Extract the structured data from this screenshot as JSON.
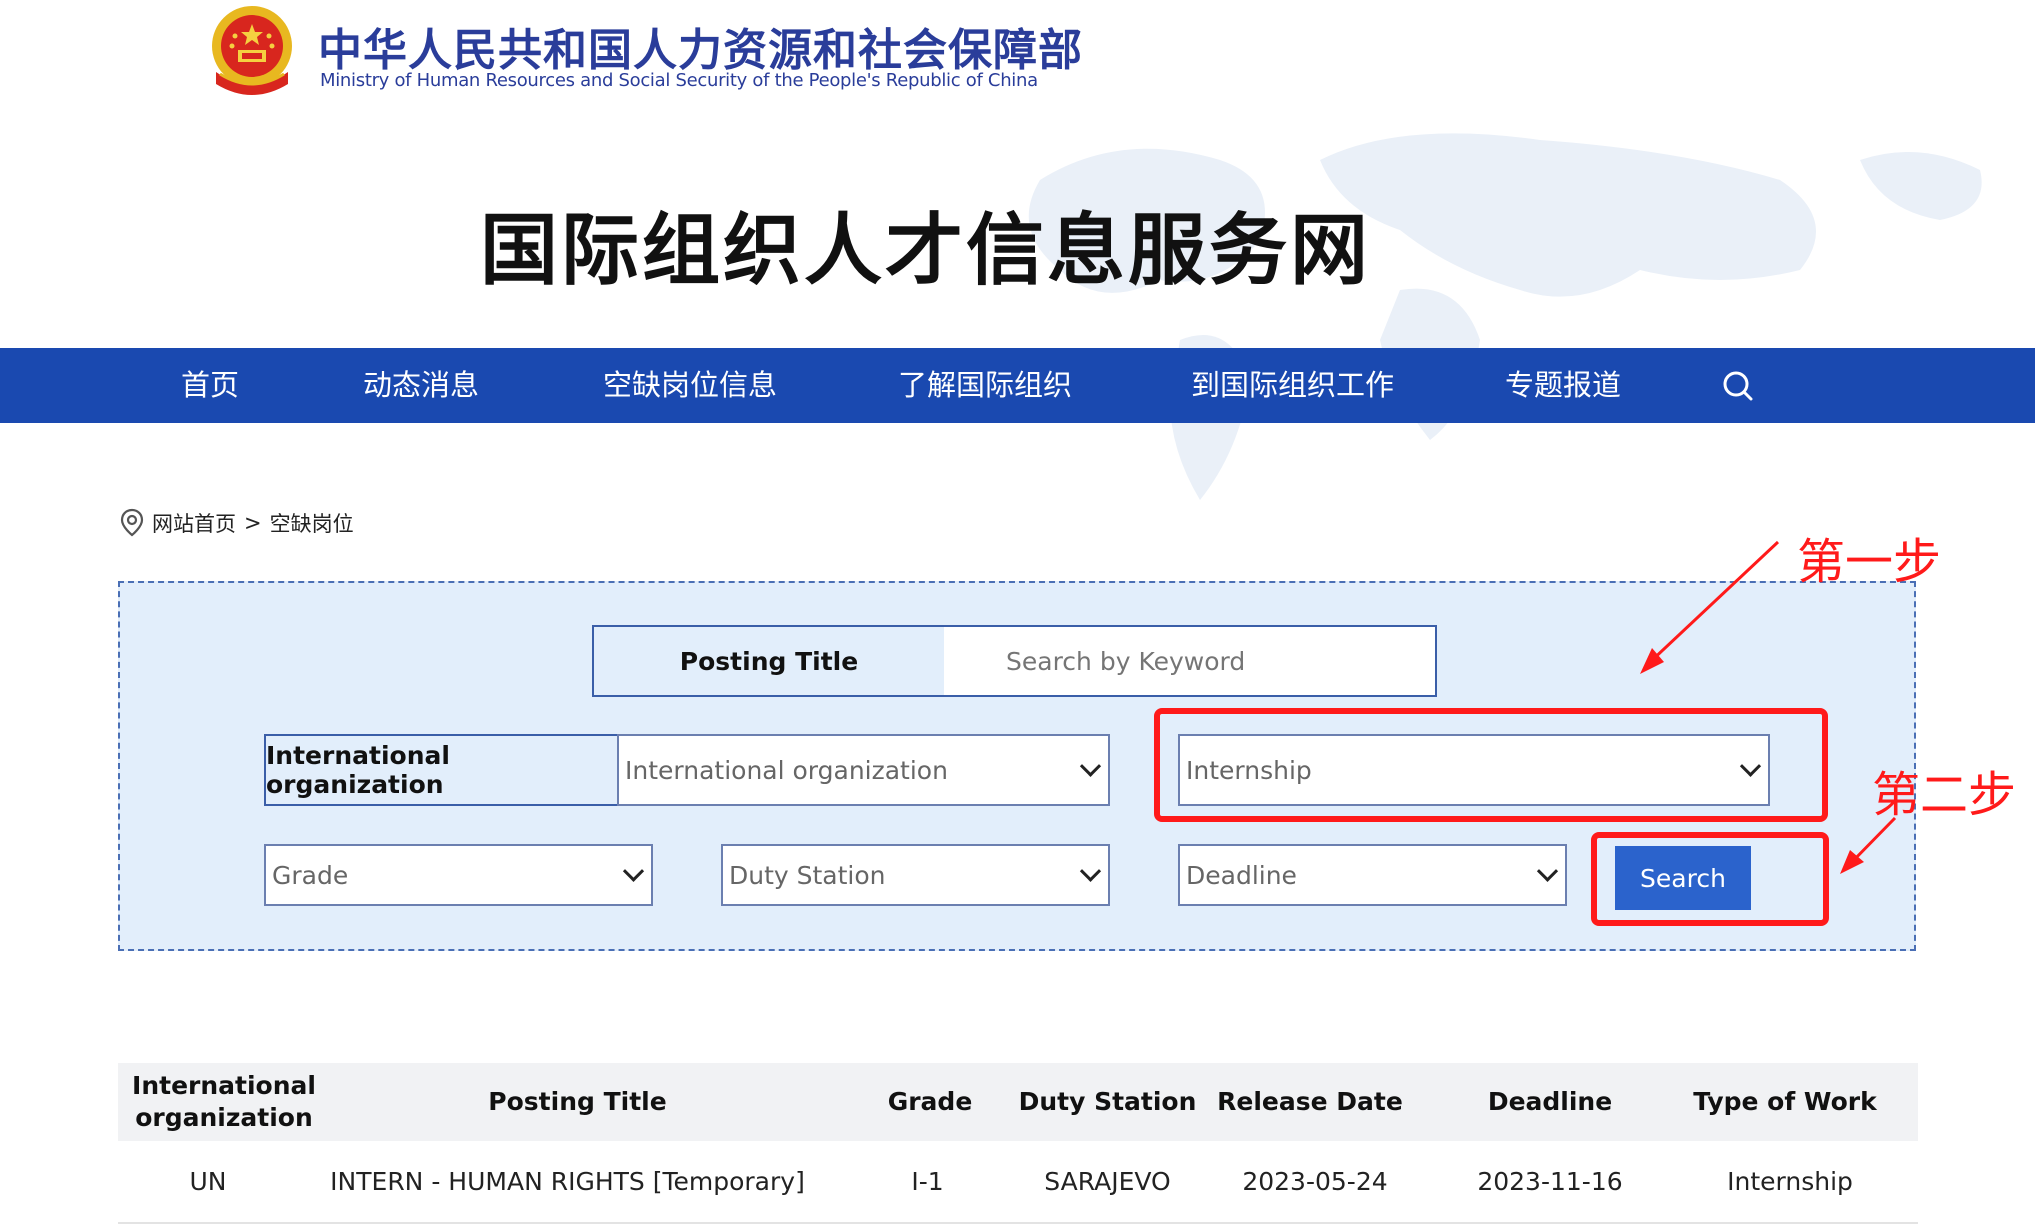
{
  "header": {
    "ministry_cn": "中华人民共和国人力资源和社会保障部",
    "ministry_en": "Ministry of Human Resources and Social Security of the People's Republic of China",
    "site_title": "国际组织人才信息服务网"
  },
  "nav": {
    "items": [
      {
        "label": "首页"
      },
      {
        "label": "动态消息"
      },
      {
        "label": "空缺岗位信息"
      },
      {
        "label": "了解国际组织"
      },
      {
        "label": "到国际组织工作"
      },
      {
        "label": "专题报道"
      }
    ],
    "search_icon": "search-icon",
    "bg_color": "#1a49b0"
  },
  "breadcrumb": {
    "home": "网站首页",
    "separator": ">",
    "current": "空缺岗位"
  },
  "filters": {
    "posting_title_label": "Posting Title",
    "keyword_placeholder": "Search by Keyword",
    "org_label": "International organization",
    "org_value": "International organization",
    "type_value": "Internship",
    "grade_value": "Grade",
    "duty_station_value": "Duty Station",
    "deadline_value": "Deadline",
    "search_button": "Search"
  },
  "annotations": {
    "step1": "第一步",
    "step2": "第二步",
    "color": "#ff1a1a"
  },
  "table": {
    "headers": {
      "org": "International organization",
      "title": "Posting Title",
      "grade": "Grade",
      "duty_station": "Duty Station",
      "release_date": "Release Date",
      "deadline": "Deadline",
      "type": "Type of Work"
    },
    "rows": [
      {
        "org": "UN",
        "title": "INTERN - HUMAN RIGHTS [Temporary]",
        "grade": "I-1",
        "duty_station": "SARAJEVO",
        "release_date": "2023-05-24",
        "deadline": "2023-11-16",
        "type": "Internship"
      }
    ]
  }
}
